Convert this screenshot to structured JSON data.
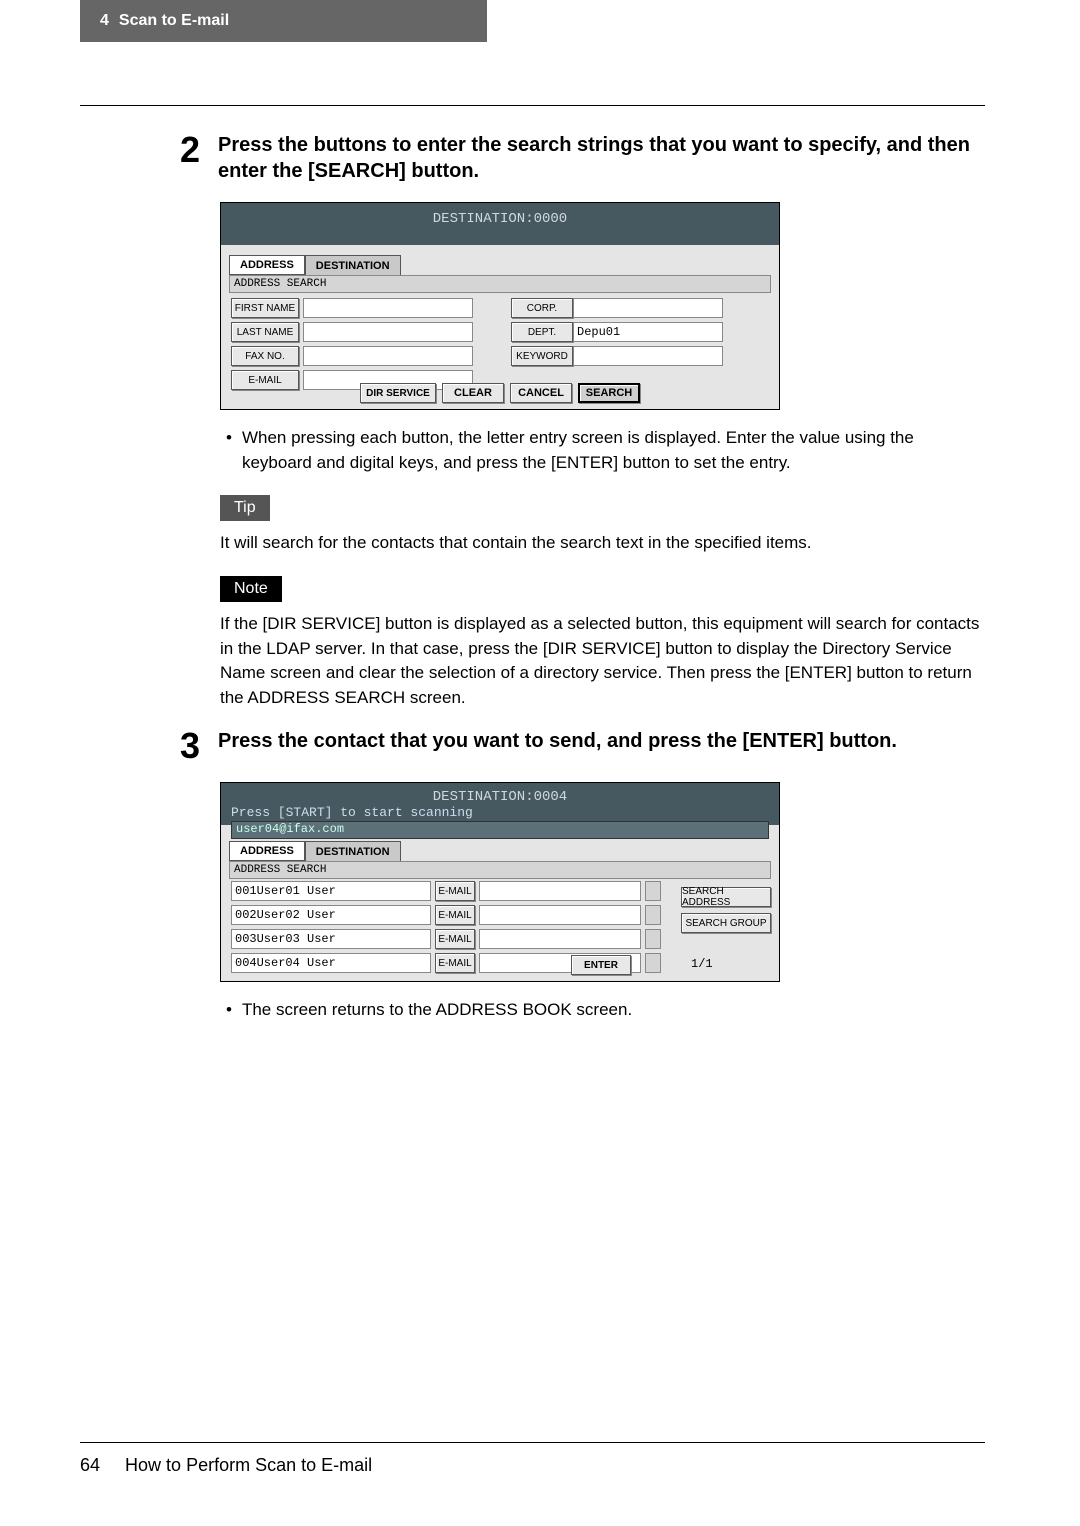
{
  "header": {
    "chapter_num": "4",
    "chapter_title": "Scan to E-mail"
  },
  "step2": {
    "num": "2",
    "text": "Press the buttons to enter the search strings that you want to specify, and then enter the [SEARCH] button."
  },
  "screenshot1": {
    "title": "DESTINATION:0000",
    "tab_address": "ADDRESS",
    "tab_destination": "DESTINATION",
    "subbar": "ADDRESS SEARCH",
    "first_name": "FIRST NAME",
    "last_name": "LAST NAME",
    "fax_no": "FAX NO.",
    "email": "E-MAIL",
    "corp": "CORP.",
    "dept": "DEPT.",
    "dept_val": "Depu01",
    "keyword": "KEYWORD",
    "dir_service": "DIR SERVICE",
    "clear": "CLEAR",
    "cancel": "CANCEL",
    "search": "SEARCH"
  },
  "bullet1": "When pressing each button, the letter entry screen is displayed.  Enter the value using the keyboard and digital keys, and press the [ENTER] button to set the entry.",
  "tip_label": "Tip",
  "tip_text": "It will search for the contacts that contain the search text in the specified items.",
  "note_label": "Note",
  "note_text": "If the [DIR SERVICE] button is displayed as a selected button, this equipment will search for contacts in the LDAP server.  In that case, press the [DIR SERVICE] button to display the Directory Service Name screen and clear the selection of a directory service.  Then press the [ENTER] button to return the ADDRESS SEARCH screen.",
  "step3": {
    "num": "3",
    "text": "Press the contact that you want to send, and press the [ENTER] button."
  },
  "screenshot2": {
    "title": "DESTINATION:0004",
    "start": "Press [START] to start scanning",
    "user": "user04@ifax.com",
    "tab_address": "ADDRESS",
    "tab_destination": "DESTINATION",
    "subbar": "ADDRESS SEARCH",
    "users": [
      {
        "name": "001User01 User",
        "btn": "E-MAIL"
      },
      {
        "name": "002User02 User",
        "btn": "E-MAIL"
      },
      {
        "name": "003User03 User",
        "btn": "E-MAIL"
      },
      {
        "name": "004User04 User",
        "btn": "E-MAIL"
      }
    ],
    "search_address": "SEARCH ADDRESS",
    "search_group": "SEARCH GROUP",
    "enter": "ENTER",
    "page": "1/1"
  },
  "bullet2": "The screen returns to the ADDRESS BOOK screen.",
  "footer": {
    "page_num": "64",
    "title": "How to Perform Scan to E-mail"
  }
}
